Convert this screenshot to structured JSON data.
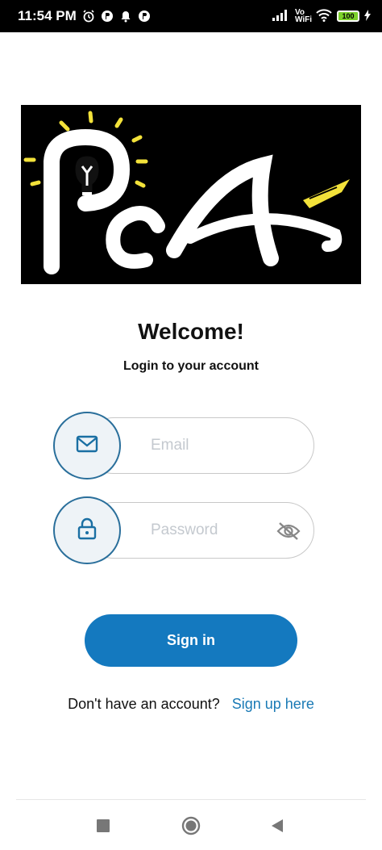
{
  "status_bar": {
    "time": "11:54 PM",
    "network": "Vo WiFi",
    "battery": "100"
  },
  "logo": {
    "icon": "pca-logo"
  },
  "heading": {
    "title": "Welcome!",
    "subtitle": "Login to your account"
  },
  "form": {
    "email_placeholder": "Email",
    "password_placeholder": "Password",
    "sign_in_label": "Sign in"
  },
  "signup": {
    "prompt": "Don't have an account?",
    "link_label": "Sign up here"
  },
  "colors": {
    "primary": "#1479bf",
    "link": "#1a7ab5",
    "icon_accent": "#2a6f9b"
  }
}
